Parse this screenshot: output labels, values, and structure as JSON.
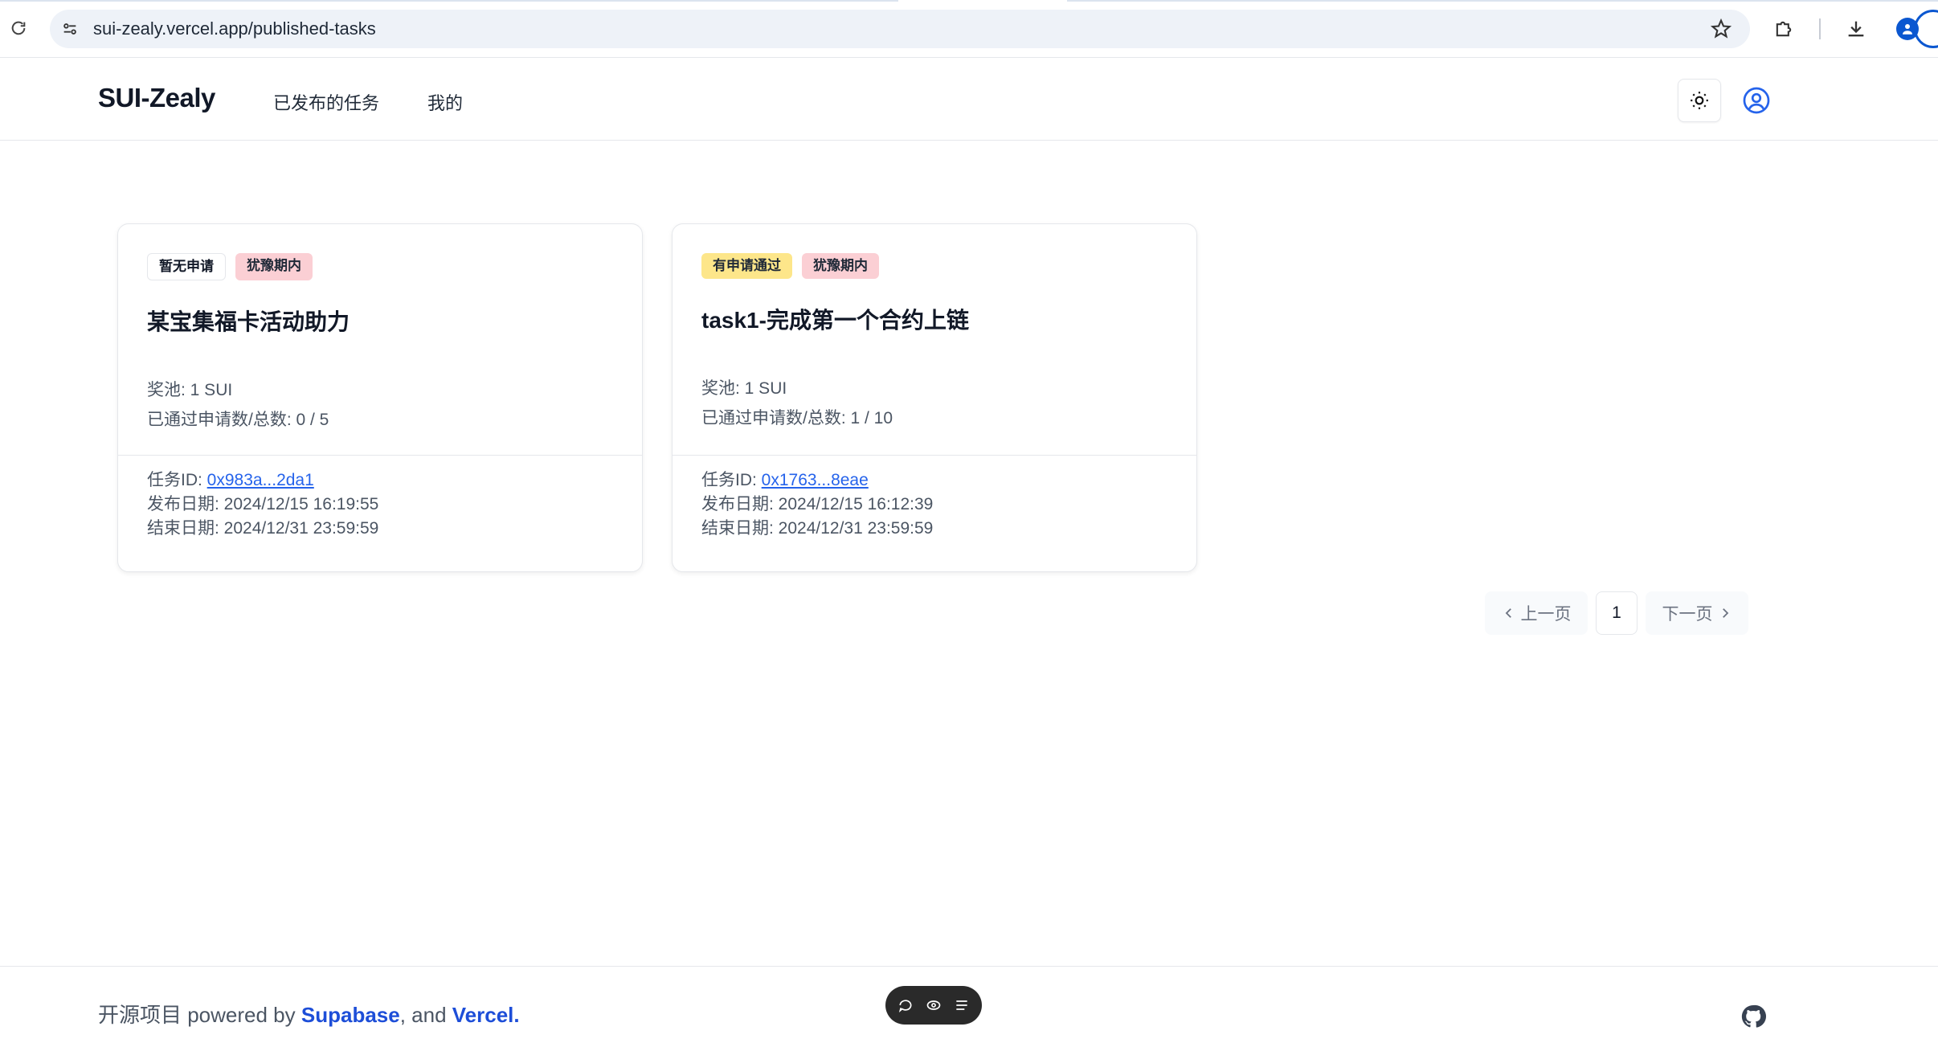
{
  "browser": {
    "url": "sui-zealy.vercel.app/published-tasks"
  },
  "header": {
    "brand": "SUI-Zealy",
    "nav": [
      "已发布的任务",
      "我的"
    ]
  },
  "cards": [
    {
      "badges": [
        "暂无申请",
        "犹豫期内"
      ],
      "title": "某宝集福卡活动助力",
      "prize": "奖池: 1 SUI",
      "approved": "已通过申请数/总数: 0 / 5",
      "task_id_label": "任务ID: ",
      "task_id": "0x983a...2da1",
      "publish_date": "发布日期: 2024/12/15 16:19:55",
      "end_date": "结束日期: 2024/12/31 23:59:59"
    },
    {
      "badges": [
        "有申请通过",
        "犹豫期内"
      ],
      "title": "task1-完成第一个合约上链",
      "prize": "奖池: 1 SUI",
      "approved": "已通过申请数/总数: 1 / 10",
      "task_id_label": "任务ID: ",
      "task_id": "0x1763...8eae",
      "publish_date": "发布日期: 2024/12/15 16:12:39",
      "end_date": "结束日期: 2024/12/31 23:59:59"
    }
  ],
  "pagination": {
    "prev": "上一页",
    "current": "1",
    "next": "下一页"
  },
  "footer": {
    "prefix": "开源项目 powered by ",
    "supabase": "Supabase",
    "sep": ", and ",
    "vercel": "Vercel",
    "dot": "."
  },
  "colors": {
    "accent": "#2563eb",
    "badge_hesitation": "#fbcfd4",
    "badge_approved": "#fde68a"
  }
}
